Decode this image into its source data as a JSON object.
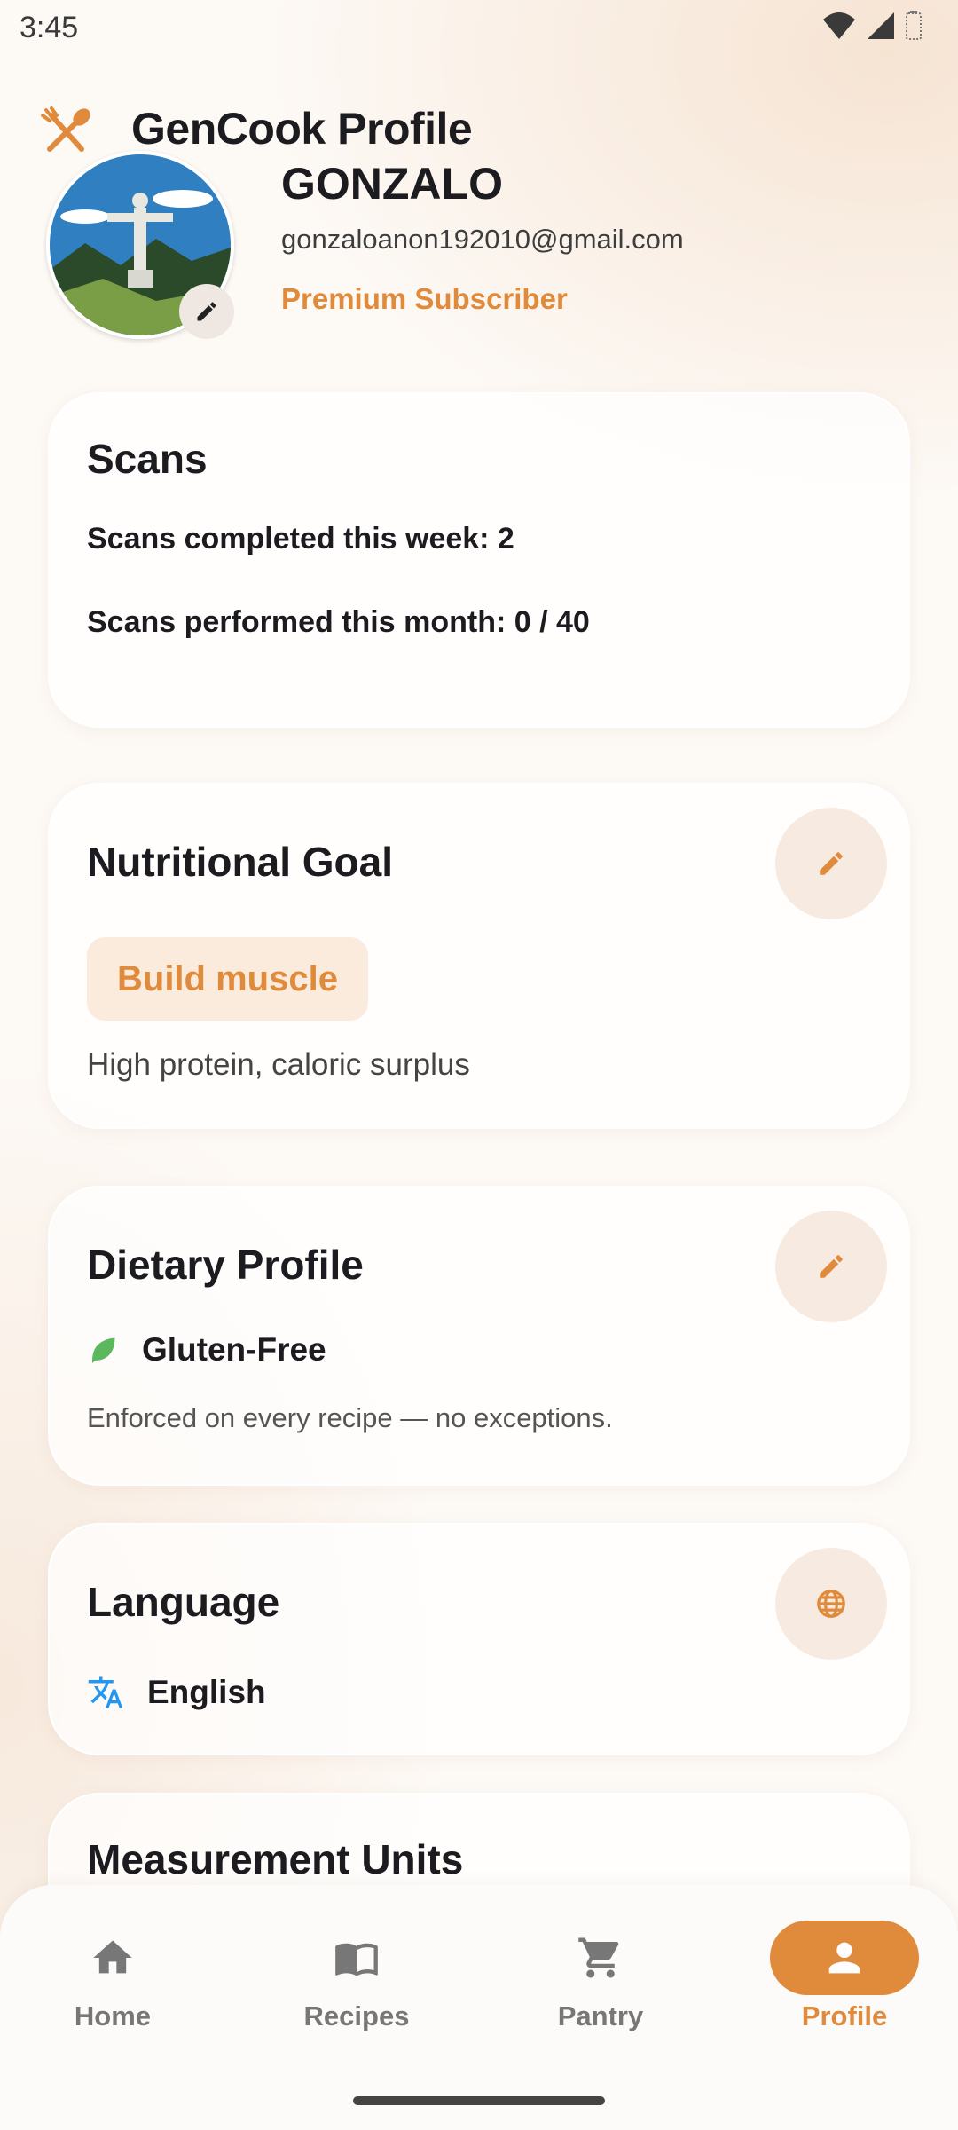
{
  "status_bar": {
    "time": "3:45"
  },
  "header": {
    "title": "GenCook Profile"
  },
  "profile": {
    "name": "GONZALO",
    "email": "gonzaloanon192010@gmail.com",
    "tier": "Premium Subscriber"
  },
  "scans": {
    "title": "Scans",
    "week_line": "Scans completed this week: 2",
    "month_line": "Scans performed this month: 0 / 40"
  },
  "nutrition": {
    "title": "Nutritional Goal",
    "goal": "Build muscle",
    "description": "High protein, caloric surplus"
  },
  "dietary": {
    "title": "Dietary Profile",
    "item": "Gluten-Free",
    "note": "Enforced on every recipe — no exceptions."
  },
  "language": {
    "title": "Language",
    "value": "English"
  },
  "units": {
    "title": "Measurement Units"
  },
  "nav": {
    "items": [
      {
        "label": "Home"
      },
      {
        "label": "Recipes"
      },
      {
        "label": "Pantry"
      },
      {
        "label": "Profile"
      }
    ],
    "active": "Profile"
  },
  "colors": {
    "accent": "#e08a3c",
    "leaf": "#5cb85c",
    "translate": "#2196f3"
  }
}
